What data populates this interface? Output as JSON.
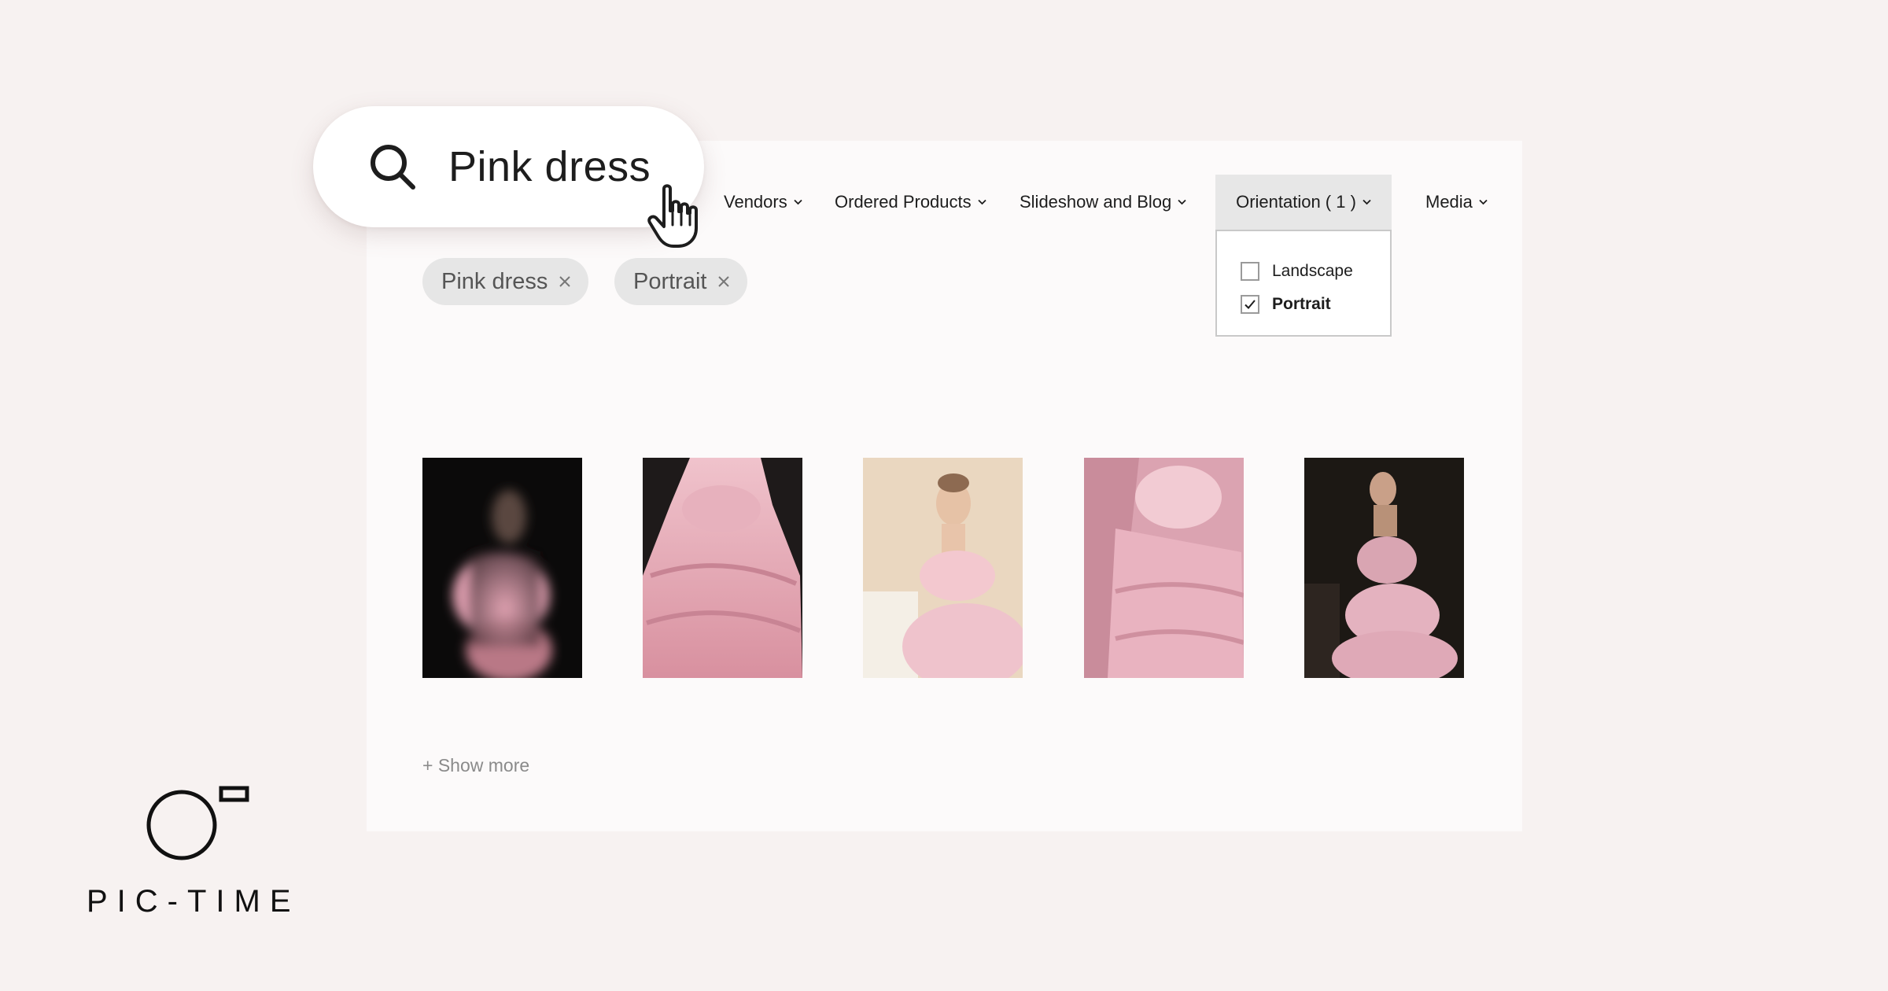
{
  "search": {
    "query": "Pink dress"
  },
  "nav": {
    "vendors": "Vendors",
    "ordered_products": "Ordered Products",
    "slideshow_blog": "Slideshow and Blog",
    "orientation": "Orientation ( 1 )",
    "media": "Media"
  },
  "orientation_dropdown": {
    "options": [
      {
        "label": "Landscape",
        "checked": false
      },
      {
        "label": "Portrait",
        "checked": true
      }
    ]
  },
  "filters": {
    "chips": [
      {
        "label": "Pink dress"
      },
      {
        "label": "Portrait"
      }
    ]
  },
  "results": {
    "photos": [
      {
        "icon": "photo-blurred-pink-dress-dark"
      },
      {
        "icon": "photo-pink-tulle-skirt"
      },
      {
        "icon": "photo-woman-pink-dress-light-room"
      },
      {
        "icon": "photo-pink-ruffled-dress-closeup"
      },
      {
        "icon": "photo-woman-pink-dress-dark-room"
      }
    ],
    "show_more": "+ Show more"
  },
  "brand": {
    "name": "PIC-TIME",
    "accent_color": "#f0b9c6",
    "background_color": "#f7f2f1"
  }
}
